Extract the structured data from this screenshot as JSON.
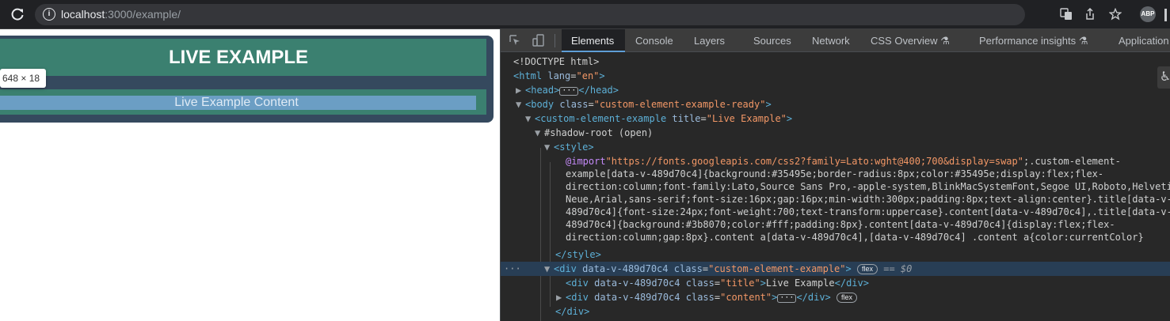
{
  "browser": {
    "url_host": "localhost",
    "url_rest": ":3000/example/",
    "profile_initials": "ABP",
    "icons": [
      "reload-icon",
      "info-icon",
      "translate-icon",
      "share-icon",
      "star-icon",
      "profile-icon",
      "menu-icon"
    ]
  },
  "page": {
    "title": "Live Example",
    "content": "Live Example Content",
    "tooltip": "648 × 18",
    "colors": {
      "background": "#35495e",
      "accent": "#3b8070",
      "text": "#ffffff"
    }
  },
  "devtools": {
    "tabs": [
      {
        "label": "Elements",
        "active": true
      },
      {
        "label": "Console"
      },
      {
        "label": "Layers"
      },
      {
        "label": "Sources"
      },
      {
        "label": "Network"
      },
      {
        "label": "CSS Overview"
      },
      {
        "label": "Performance insights"
      },
      {
        "label": "Application"
      }
    ],
    "dom": {
      "doctype": "<!DOCTYPE html>",
      "html_open": "<html",
      "html_attr": "lang",
      "html_attr_val": "\"en\"",
      "head_open": "<head>",
      "head_close": "</head>",
      "body_open": "<body",
      "body_attr": "class",
      "body_attr_val": "\"custom-element-example-ready\"",
      "ce_open": "<custom-element-example",
      "ce_attr": "title",
      "ce_attr_val": "\"Live Example\"",
      "shadow_root": "#shadow-root (open)",
      "style_open": "<style>",
      "style_close": "</style>",
      "css_import_kw": "@import",
      "css_import_url": "\"https://fonts.googleapis.com/css2?family=Lato:wght@400;700&display=swap\"",
      "css_line1_tail": ";.custom-element-",
      "css_line2": "example[data-v-489d70c4]{background:#35495e;border-radius:8px;color:#35495e;display:flex;flex-",
      "css_line3": "direction:column;font-family:Lato,Source Sans Pro,-apple-system,BlinkMacSystemFont,Segoe UI,Roboto,Helvetica",
      "css_line4": "Neue,Arial,sans-serif;font-size:16px;gap:16px;min-width:300px;padding:8px;text-align:center}.title[data-v-",
      "css_line5": "489d70c4]{font-size:24px;font-weight:700;text-transform:uppercase}.content[data-v-489d70c4],.title[data-v-",
      "css_line6": "489d70c4]{background:#3b8070;color:#fff;padding:8px}.content[data-v-489d70c4]{display:flex;flex-",
      "css_line7": "direction:column;gap:8px}.content a[data-v-489d70c4],[data-v-489d70c4] .content a{color:currentColor}",
      "div_open": "<div",
      "div_dv": "data-v-489d70c4",
      "div_class": "class",
      "div_class_val": "\"custom-element-example\"",
      "flex_badge": "flex",
      "eq": "==",
      "dollar0": "$0",
      "title_dv": "data-v-489d70c4",
      "title_class_val": "\"title\"",
      "title_text": "Live Example",
      "div_close": "</div>",
      "content_dv": "data-v-489d70c4",
      "content_class_val": "\"content\"",
      "ellipsis": "···",
      "selected_marker": "···"
    }
  }
}
